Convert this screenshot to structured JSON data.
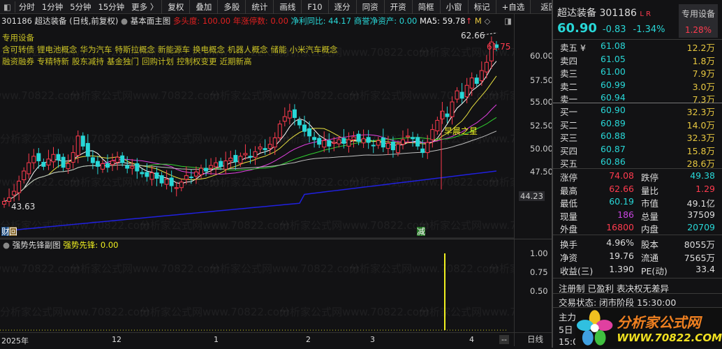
{
  "toolbar": {
    "items": [
      "分时",
      "1分钟",
      "5分钟",
      "15分钟",
      "更多 〉"
    ],
    "buttons": [
      "复权",
      "叠加",
      "多股",
      "统计",
      "画线",
      "F10",
      "逐分",
      "同资",
      "开资",
      "简框",
      "小窗",
      "标记",
      "+自选",
      "返回"
    ]
  },
  "info": {
    "code_name": "301186 超达装备 (日线,前复权)",
    "main_chart": "基本面主图",
    "bull": "多头度: 100.00",
    "limit_up_count": "年涨停数: 0.00",
    "profit_yoy": "净利同比: 44.17",
    "goodwill": "商誉净资产: 0.00",
    "ma5": "MA5: 59.78",
    "m_label": "M"
  },
  "concepts": {
    "industry": "专用设备",
    "line1": [
      "含可转债",
      "锂电池概念",
      "华为汽车",
      "特斯拉概念",
      "新能源车",
      "换电概念",
      "机器人概念",
      "储能",
      "小米汽车概念"
    ],
    "line2": [
      "融资融券",
      "专精特新",
      "股东减持",
      "基金独门",
      "回购计划",
      "控制权变更",
      "近期新高"
    ]
  },
  "chart": {
    "high_label": "62.66",
    "recent_label": "61.75",
    "low_label": "43.63",
    "star_label": "早晨之星",
    "badge_cai": "财",
    "badge_hui": "回",
    "badge_jian": "减",
    "axis": [
      "60.00",
      "57.50",
      "55.00",
      "52.50",
      "50.00",
      "47.50"
    ],
    "axis_current": "44.23",
    "closes": [
      44.2,
      44.6,
      45.3,
      46.4,
      47.5,
      48.4,
      49.1,
      48.6,
      48.0,
      48.8,
      49.3,
      48.7,
      47.9,
      48.3,
      49.5,
      51.3,
      50.2,
      49.1,
      48.4,
      48.0,
      48.3,
      47.9,
      48.6,
      49.0,
      48.4,
      47.8,
      48.0,
      47.5,
      47.2,
      46.9,
      47.3,
      46.7,
      46.2,
      46.6,
      45.9,
      45.7,
      46.3,
      47.0,
      46.8,
      47.4,
      47.8,
      47.5,
      48.1,
      48.4,
      48.0,
      48.6,
      48.9,
      48.5,
      49.1,
      49.4,
      49.0,
      49.6,
      50.1,
      49.8,
      50.4,
      51.1,
      52.6,
      53.4,
      54.0,
      53.3,
      52.5,
      51.8,
      51.3,
      50.9,
      50.4,
      50.8,
      50.2,
      50.6,
      50.9,
      50.5,
      50.9,
      51.2,
      50.7,
      51.0,
      50.6,
      50.3,
      50.8,
      50.1,
      50.5,
      49.8,
      50.4,
      50.9,
      51.3,
      51.0,
      50.2,
      49.5,
      50.6,
      52.0,
      53.0,
      54.0,
      53.4,
      55.0,
      56.2,
      55.4,
      56.8,
      57.6,
      57.0,
      58.4,
      59.3,
      61.5,
      60.9
    ]
  },
  "sub": {
    "title": "强势先锋副图",
    "value_label": "强势先锋: 0.00",
    "axis": [
      "1.00",
      "0.75",
      "0.50"
    ],
    "signal_value": 1.0
  },
  "timeline": {
    "labels": [
      "2025年",
      "12",
      "1",
      "2",
      "3",
      "4"
    ],
    "period": "日线",
    "dash": "--"
  },
  "quote": {
    "name": "超达装备",
    "code": "301186",
    "lr": "L R",
    "sector": "专用设备",
    "sector_pct": "1.28%",
    "price": "60.90",
    "change": "-0.83",
    "pct": "-1.34%",
    "asks": [
      {
        "label": "卖五 ¥",
        "price": "61.08",
        "vol": "12.2万"
      },
      {
        "label": "卖四",
        "price": "61.05",
        "vol": "1.8万"
      },
      {
        "label": "卖三",
        "price": "61.00",
        "vol": "7.9万"
      },
      {
        "label": "卖二",
        "price": "60.99",
        "vol": "3.0万"
      },
      {
        "label": "卖一",
        "price": "60.94",
        "vol": "7.3万"
      }
    ],
    "bids": [
      {
        "label": "买一",
        "price": "60.90",
        "vol": "32.3万"
      },
      {
        "label": "买二",
        "price": "60.89",
        "vol": "14.0万"
      },
      {
        "label": "买三",
        "price": "60.88",
        "vol": "32.3万"
      },
      {
        "label": "买四",
        "price": "60.87",
        "vol": "15.8万"
      },
      {
        "label": "买五",
        "price": "60.86",
        "vol": "28.6万"
      }
    ],
    "stats": [
      [
        "涨停",
        "74.08",
        "跌停",
        "49.38"
      ],
      [
        "最高",
        "62.66",
        "量比",
        "1.29"
      ],
      [
        "最低",
        "60.19",
        "市值",
        "49.1亿"
      ],
      [
        "现量",
        "186",
        "总量",
        "37509"
      ],
      [
        "外盘",
        "16800",
        "内盘",
        "20709"
      ]
    ],
    "stats2": [
      [
        "换手",
        "4.96%",
        "股本",
        "8055万"
      ],
      [
        "净资",
        "19.76",
        "流通",
        "7565万"
      ],
      [
        "收益(三)",
        "1.390",
        "PE(动)",
        "33.4"
      ]
    ],
    "tags": "注册制 已盈利 表决权无差异",
    "status": "交易状态: 闭市阶段 15:30:00",
    "partial": [
      "主力",
      "5日",
      "15:0"
    ]
  },
  "logo": {
    "text": "分析家公式网",
    "url": "WWW.70822.COM"
  },
  "watermark": "分析家公式网www.70822.com",
  "colors": {
    "up": "#ff3b4e",
    "down": "#28d7d7",
    "ma5": "#ffffff",
    "ma10": "#e8e040",
    "ma20": "#e040e0",
    "ma30": "#30d030",
    "ma60": "#c0c0c0",
    "ma120": "#2020e0"
  }
}
